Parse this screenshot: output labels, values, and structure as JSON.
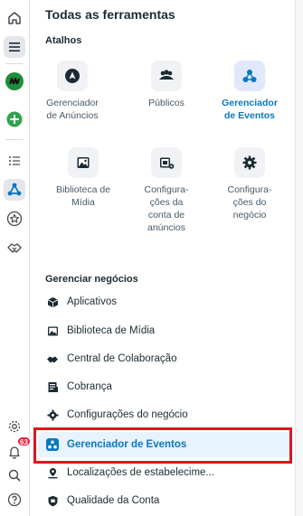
{
  "colors": {
    "accent": "#0a78be",
    "highlight": "#e0141e",
    "badge": "#e41e3f"
  },
  "rail": {
    "items": [
      {
        "icon": "home-icon"
      },
      {
        "icon": "menu-icon"
      },
      {
        "icon": "meta-business-logo-icon"
      },
      {
        "icon": "create-plus-icon"
      },
      {
        "icon": "list-icon"
      },
      {
        "icon": "events-manager-icon"
      },
      {
        "icon": "star-icon"
      },
      {
        "icon": "handshake-icon"
      },
      {
        "icon": "settings-icon"
      },
      {
        "icon": "notifications-bell-icon",
        "badge": "63"
      },
      {
        "icon": "search-icon"
      },
      {
        "icon": "help-icon"
      }
    ]
  },
  "panel": {
    "title": "Todas as ferramentas",
    "shortcuts": {
      "heading": "Atalhos",
      "tiles": [
        {
          "label": "Gerenciador\nde Anúncios",
          "icon": "ads-manager-icon"
        },
        {
          "label": "Públicos",
          "icon": "audiences-icon"
        },
        {
          "label": "Gerenciador\nde Eventos",
          "icon": "events-manager-icon",
          "active": true
        },
        {
          "label": "Biblioteca de\nMídia",
          "icon": "media-library-icon"
        },
        {
          "label": "Configura-\nções da\nconta de\nanúncios",
          "icon": "ad-account-settings-icon"
        },
        {
          "label": "Configura-\nções do\nnegócio",
          "icon": "business-settings-icon"
        }
      ]
    },
    "manage": {
      "heading": "Gerenciar negócios",
      "items": [
        {
          "label": "Aplicativos",
          "icon": "apps-cube-icon"
        },
        {
          "label": "Biblioteca de Mídia",
          "icon": "media-library-icon"
        },
        {
          "label": "Central de Colaboração",
          "icon": "collaboration-icon"
        },
        {
          "label": "Cobrança",
          "icon": "billing-icon"
        },
        {
          "label": "Configurações do negócio",
          "icon": "gear-icon"
        },
        {
          "label": "Gerenciador de Eventos",
          "icon": "events-manager-icon",
          "active": true
        },
        {
          "label": "Localizações de estabelecime...",
          "icon": "location-pin-icon"
        },
        {
          "label": "Qualidade da Conta",
          "icon": "shield-icon"
        }
      ]
    }
  }
}
